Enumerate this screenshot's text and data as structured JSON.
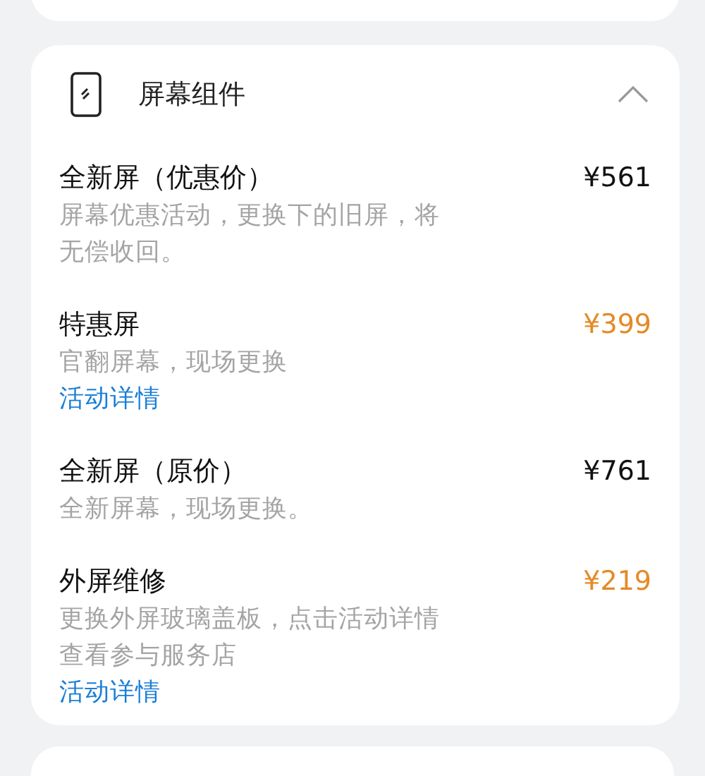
{
  "section": {
    "title": "屏幕组件",
    "expanded": true
  },
  "items": [
    {
      "name": "全新屏（优惠价）",
      "price": "¥561",
      "highlight": false,
      "description": "屏幕优惠活动，更换下的旧屏，将无偿收回。"
    },
    {
      "name": "特惠屏",
      "price": "¥399",
      "highlight": true,
      "description": "官翻屏幕，现场更换",
      "link": "活动详情"
    },
    {
      "name": "全新屏（原价）",
      "price": "¥761",
      "highlight": false,
      "description": "全新屏幕，现场更换。"
    },
    {
      "name": "外屏维修",
      "price": "¥219",
      "highlight": true,
      "description": "更换外屏玻璃盖板，点击活动详情查看参与服务店",
      "link": "活动详情"
    }
  ]
}
